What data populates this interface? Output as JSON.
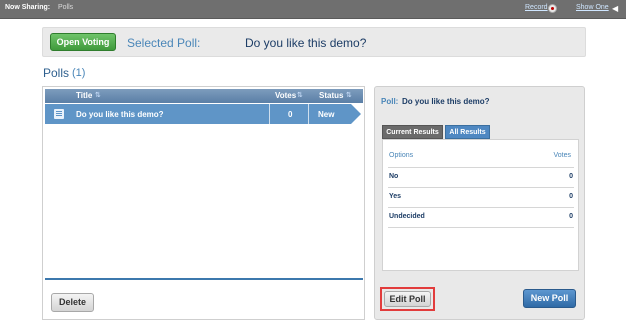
{
  "topbar": {
    "sharing_label": "Now Sharing:",
    "sharing_value": "Polls",
    "record": "Record",
    "show_one": "Show One"
  },
  "header": {
    "open_voting": "Open Voting",
    "selected_label": "Selected Poll:",
    "selected_value": "Do you like this demo?"
  },
  "polls": {
    "title": "Polls",
    "count": "(1)",
    "columns": [
      "Title",
      "Votes",
      "Status"
    ],
    "rows": [
      {
        "title": "Do you like this demo?",
        "votes": "0",
        "status": "New"
      }
    ],
    "delete": "Delete"
  },
  "detail": {
    "poll_label": "Poll:",
    "poll_value": "Do you like this demo?",
    "tabs": [
      "Current Results",
      "All Results"
    ],
    "results_headers": {
      "options": "Options",
      "votes": "Votes"
    },
    "results": [
      {
        "option": "No",
        "votes": "0"
      },
      {
        "option": "Yes",
        "votes": "0"
      },
      {
        "option": "Undecided",
        "votes": "0"
      }
    ],
    "edit_poll": "Edit Poll",
    "new_poll": "New Poll"
  },
  "colors": {
    "accent": "#4a86b8",
    "open_voting": "#4fae4b",
    "highlight": "#e23c3c"
  }
}
